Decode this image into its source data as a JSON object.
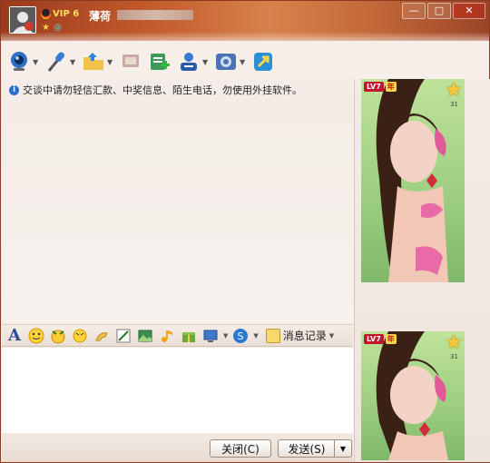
{
  "header": {
    "vip_label": "VIP 6",
    "username": "薄荷"
  },
  "window_controls": {
    "minimize": "—",
    "maximize": "□",
    "close": "✕"
  },
  "toolbar": {
    "items": [
      {
        "icon": "webcam-icon",
        "has_dropdown": true
      },
      {
        "icon": "microphone-icon",
        "has_dropdown": true
      },
      {
        "icon": "folder-icon",
        "has_dropdown": true
      },
      {
        "icon": "phone-icon",
        "has_dropdown": false
      },
      {
        "icon": "add-app-icon",
        "has_dropdown": false
      },
      {
        "icon": "group-icon",
        "has_dropdown": true
      },
      {
        "icon": "settings-icon",
        "has_dropdown": true
      },
      {
        "icon": "remote-assist-icon",
        "has_dropdown": false
      }
    ]
  },
  "chat": {
    "notice": "交谈中请勿轻信汇款、中奖信息、陌生电话，勿使用外挂软件。"
  },
  "input_toolbar": {
    "font_label": "A",
    "history_label": "消息记录"
  },
  "buttons": {
    "close_label": "关闭(C)",
    "send_label": "发送(S)"
  },
  "profile_cards": [
    {
      "level": "LV7",
      "year_badge": "年",
      "star_count": "31"
    },
    {
      "level": "LV7",
      "year_badge": "年",
      "star_count": "31"
    }
  ],
  "colors": {
    "header_accent": "#c25a2b",
    "vip_gold": "#ffde59",
    "notice_icon": "#2a6bd1"
  }
}
